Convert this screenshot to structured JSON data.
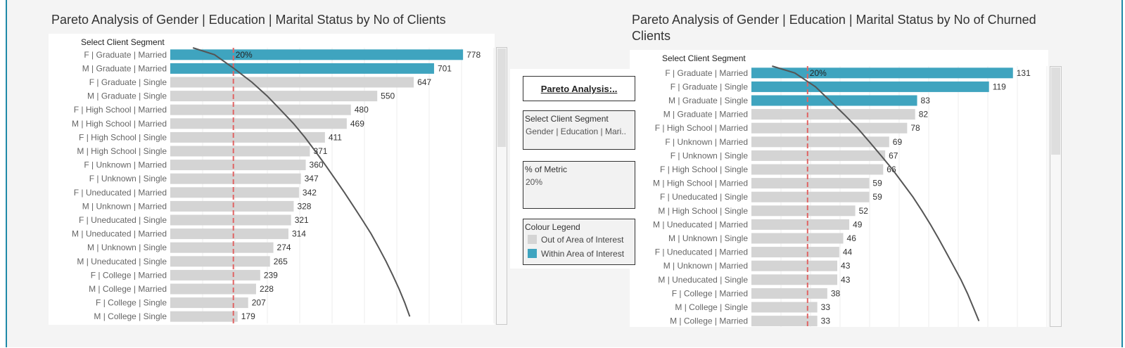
{
  "colors": {
    "out": "#d4d4d4",
    "within": "#3fa4bf",
    "curve": "#555555",
    "marker": "#e06464"
  },
  "left": {
    "title": "Pareto Analysis of Gender | Education | Marital Status by No of Clients",
    "header": "Select Client Segment",
    "marker_label": "20%"
  },
  "right": {
    "title_line1": "Pareto Analysis of Gender | Education | Marital Status by No of Churned",
    "title_line2": "Clients",
    "header": "Select Client Segment",
    "marker_label": "20%"
  },
  "controls": {
    "pareto_button": "Pareto Analysis:..",
    "segment_header": "Select Client Segment",
    "segment_value": "Gender | Education | Mari..",
    "metric_header": "% of Metric",
    "metric_value": "20%",
    "legend_header": "Colour Legend",
    "legend_out": "Out of Area of Interest",
    "legend_within": "Within Area of Interest"
  },
  "chart_data": [
    {
      "type": "bar",
      "orientation": "horizontal",
      "title": "Pareto Analysis of Gender | Education | Marital Status by No of Clients",
      "marker": "20%",
      "categories": [
        "F | Graduate | Married",
        "M | Graduate | Married",
        "F | Graduate | Single",
        "M | Graduate | Single",
        "F | High School | Married",
        "M | High School | Married",
        "F | High School | Single",
        "M | High School | Single",
        "F | Unknown | Married",
        "F | Unknown | Single",
        "F | Uneducated | Married",
        "M | Unknown | Married",
        "F | Uneducated | Single",
        "M | Uneducated | Married",
        "M | Unknown | Single",
        "M | Uneducated | Single",
        "F | College | Married",
        "M | College | Married",
        "F | College | Single",
        "M | College | Single"
      ],
      "values": [
        778,
        701,
        647,
        550,
        480,
        469,
        411,
        371,
        360,
        347,
        342,
        328,
        321,
        314,
        274,
        265,
        239,
        228,
        207,
        179
      ],
      "within_area_of_interest": [
        true,
        true,
        false,
        false,
        false,
        false,
        false,
        false,
        false,
        false,
        false,
        false,
        false,
        false,
        false,
        false,
        false,
        false,
        false,
        false
      ],
      "xlim": [
        0,
        860
      ]
    },
    {
      "type": "bar",
      "orientation": "horizontal",
      "title": "Pareto Analysis of Gender | Education | Marital Status by No of Churned Clients",
      "marker": "20%",
      "categories": [
        "F | Graduate | Married",
        "F | Graduate | Single",
        "M | Graduate | Single",
        "M | Graduate | Married",
        "F | High School | Married",
        "F | Unknown | Married",
        "F | Unknown | Single",
        "F | High School | Single",
        "M | High School | Married",
        "F | Uneducated | Single",
        "M | High School | Single",
        "M | Uneducated | Married",
        "M | Unknown | Single",
        "F | Uneducated | Married",
        "M | Unknown | Married",
        "M | Uneducated | Single",
        "F | College | Married",
        "M | College | Single",
        "M | College | Married"
      ],
      "values": [
        131,
        119,
        83,
        82,
        78,
        69,
        67,
        66,
        59,
        59,
        52,
        49,
        46,
        44,
        43,
        43,
        38,
        33,
        33
      ],
      "within_area_of_interest": [
        true,
        true,
        true,
        false,
        false,
        false,
        false,
        false,
        false,
        false,
        false,
        false,
        false,
        false,
        false,
        false,
        false,
        false,
        false
      ],
      "xlim": [
        0,
        148
      ]
    }
  ]
}
